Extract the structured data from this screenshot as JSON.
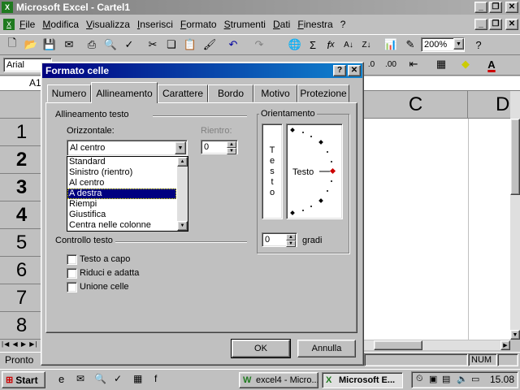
{
  "app": {
    "title": "Microsoft Excel - Cartel1",
    "menu": [
      "File",
      "Modifica",
      "Visualizza",
      "Inserisci",
      "Formato",
      "Strumenti",
      "Dati",
      "Finestra",
      "?"
    ],
    "zoom": "200%",
    "font_name": "Arial",
    "name_box": "A1",
    "column_c": "C",
    "column_d": "D",
    "rows": [
      "1",
      "2",
      "3",
      "4",
      "5",
      "6",
      "7",
      "8"
    ],
    "status_left": "Pronto",
    "status_num": "NUM"
  },
  "dialog": {
    "title": "Formato celle",
    "tabs": [
      "Numero",
      "Allineamento",
      "Carattere",
      "Bordo",
      "Motivo",
      "Protezione"
    ],
    "active_tab": "Allineamento",
    "alignment_group": "Allineamento testo",
    "horizontal_label": "Orizzontale:",
    "horizontal_value": "Al centro",
    "indent_label": "Rientro:",
    "indent_value": "0",
    "horizontal_options": [
      "Standard",
      "Sinistro (rientro)",
      "Al centro",
      "A destra",
      "Riempi",
      "Giustifica",
      "Centra nelle colonne"
    ],
    "selected_option": "A destra",
    "orientation_group": "Orientamento",
    "vertical_text": [
      "T",
      "e",
      "s",
      "t",
      "o"
    ],
    "orientation_text": "Testo",
    "degrees_value": "0",
    "degrees_label": "gradi",
    "control_group": "Controllo testo",
    "checkboxes": [
      "Testo a capo",
      "Riduci e adatta",
      "Unione celle"
    ],
    "ok_label": "OK",
    "cancel_label": "Annulla"
  },
  "taskbar": {
    "start_label": "Start",
    "tasks": [
      "excel4 - Micro...",
      "Microsoft E..."
    ],
    "clock": "15.08"
  },
  "colors": {
    "title_active": "#000080",
    "title_gradient": "#1084d0",
    "selection": "#000080",
    "accent_red": "#cc0000"
  }
}
